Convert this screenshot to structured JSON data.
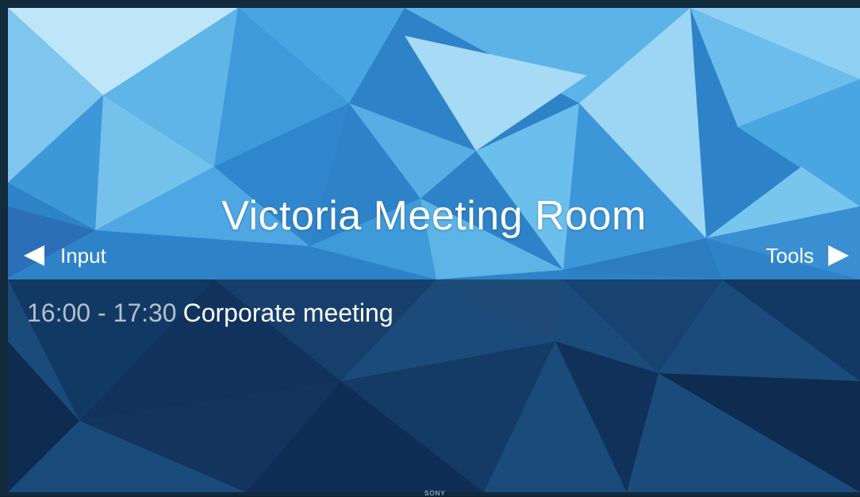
{
  "room": {
    "name": "Victoria Meeting Room"
  },
  "nav": {
    "left_label": "Input",
    "right_label": "Tools",
    "left_icon": "triangle-left-arrow",
    "right_icon": "triangle-right-arrow"
  },
  "schedule": [
    {
      "time": "16:00 - 17:30",
      "title": "Corporate meeting"
    }
  ],
  "brand": "SONY",
  "colors": {
    "background_primary": "#2d7fc4",
    "background_light": "#8ad0f2",
    "background_dark": "#0f2f55",
    "text_primary": "#ffffff",
    "text_secondary": "#b3bfcc"
  }
}
